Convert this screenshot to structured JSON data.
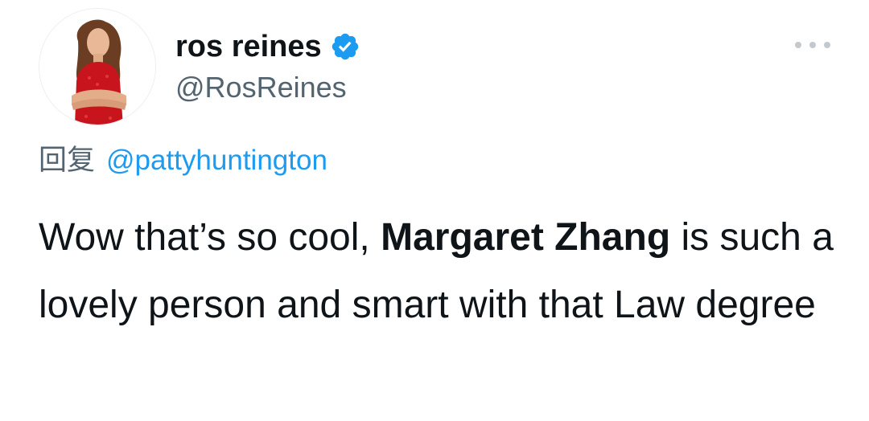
{
  "author": {
    "display_name": "ros reines",
    "handle": "@RosReines",
    "verified": true,
    "avatar_icon": "profile-photo-icon"
  },
  "menu": {
    "icon": "more-options-icon"
  },
  "reply": {
    "prefix": "回复",
    "mention": "@pattyhuntington"
  },
  "tweet": {
    "text_before": "Wow that’s so cool, ",
    "mention_bold": "Margaret Zhang",
    "text_after": " is such a lovely person and smart with that Law degree"
  },
  "colors": {
    "accent": "#1d9bf0",
    "text": "#0f1419",
    "secondary": "#536471"
  }
}
